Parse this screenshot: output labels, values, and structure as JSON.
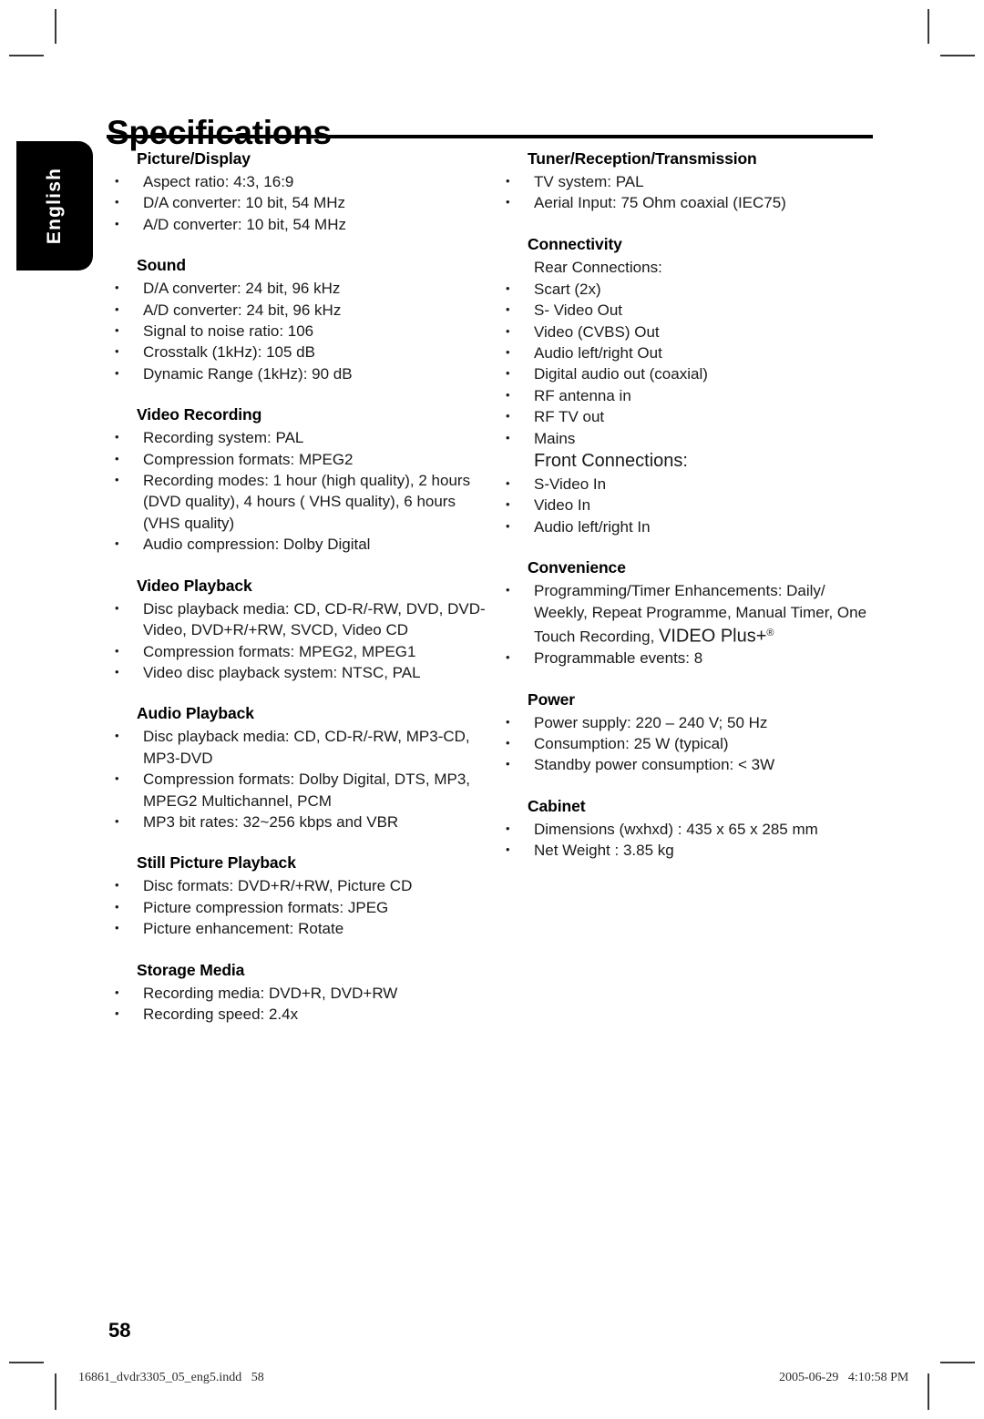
{
  "page": {
    "title": "Specifications",
    "language_tab": "English",
    "page_number": "58"
  },
  "footer": {
    "file_info": "16861_dvdr3305_05_eng5.indd   58",
    "timestamp": "2005-06-29   4:10:58 PM"
  },
  "left_column": [
    {
      "heading": "Picture/Display",
      "items": [
        "Aspect ratio: 4:3, 16:9",
        "D/A converter: 10 bit, 54 MHz",
        "A/D converter: 10 bit, 54 MHz"
      ]
    },
    {
      "heading": "Sound",
      "items": [
        "D/A converter: 24 bit, 96 kHz",
        "A/D converter: 24 bit, 96 kHz",
        "Signal to noise ratio: 106",
        "Crosstalk (1kHz): 105 dB",
        "Dynamic Range (1kHz): 90 dB"
      ]
    },
    {
      "heading": "Video Recording",
      "items": [
        "Recording system: PAL",
        "Compression formats: MPEG2",
        "Recording modes: 1 hour (high quality), 2 hours (DVD quality), 4 hours ( VHS quality), 6 hours (VHS quality)",
        "Audio compression: Dolby Digital"
      ]
    },
    {
      "heading": "Video Playback",
      "items": [
        "Disc playback media: CD, CD-R/-RW, DVD, DVD-Video, DVD+R/+RW, SVCD, Video CD",
        "Compression formats: MPEG2, MPEG1",
        "Video disc playback system: NTSC, PAL"
      ]
    },
    {
      "heading": "Audio Playback",
      "items": [
        "Disc playback media: CD, CD-R/-RW, MP3-CD, MP3-DVD",
        "Compression formats: Dolby Digital, DTS, MP3, MPEG2 Multichannel, PCM",
        "MP3 bit rates: 32~256 kbps and VBR"
      ]
    },
    {
      "heading": "Still Picture Playback",
      "items": [
        "Disc formats: DVD+R/+RW, Picture CD",
        "Picture compression formats: JPEG",
        "Picture enhancement: Rotate"
      ]
    },
    {
      "heading": "Storage Media",
      "items": [
        "Recording media: DVD+R, DVD+RW",
        "Recording speed: 2.4x"
      ]
    }
  ],
  "right_column": [
    {
      "heading": "Tuner/Reception/Transmission",
      "items": [
        "TV system: PAL",
        "Aerial Input: 75 Ohm coaxial (IEC75)"
      ]
    },
    {
      "heading": "Connectivity",
      "rear_label": "Rear Connections:",
      "rear_items": [
        "Scart (2x)",
        "S- Video Out",
        "Video (CVBS) Out",
        "Audio left/right Out",
        "Digital audio out (coaxial)",
        "RF antenna in",
        "RF TV out",
        "Mains"
      ],
      "front_label": "Front Connections:",
      "front_items": [
        "S-Video In",
        "Video In",
        "Audio left/right In"
      ]
    },
    {
      "heading": "Convenience",
      "items": [
        "Programming/Timer Enhancements: Daily/ Weekly, Repeat Programme, Manual Timer, One Touch Recording, ",
        "Programmable events: 8"
      ],
      "video_plus_brand": "VIDEO Plus+",
      "video_plus_mark": "®"
    },
    {
      "heading": "Power",
      "items": [
        "Power supply: 220 – 240 V; 50 Hz",
        "Consumption: 25 W (typical)",
        "Standby power consumption: < 3W"
      ]
    },
    {
      "heading": "Cabinet",
      "items": [
        "Dimensions (wxhxd) : 435 x 65 x 285 mm",
        "Net Weight : 3.85 kg"
      ]
    }
  ]
}
